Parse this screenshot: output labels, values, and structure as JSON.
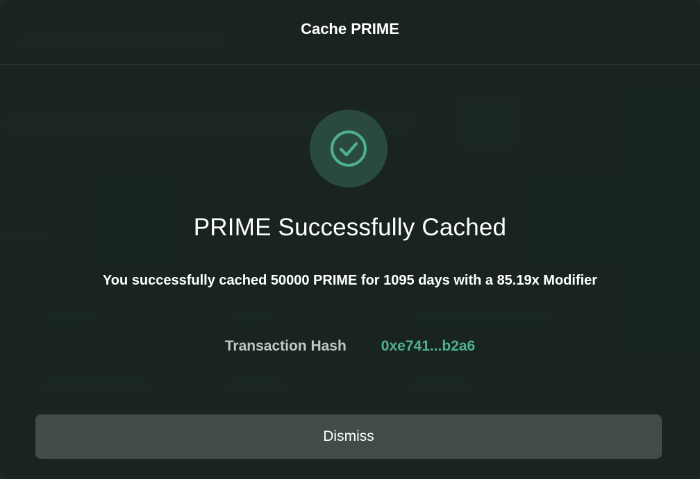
{
  "modal": {
    "title": "Cache PRIME",
    "status_icon": "check-circle-icon",
    "heading": "PRIME Successfully Cached",
    "message": "You successfully cached 50000 PRIME for 1095 days with a 85.19x Modifier",
    "transaction": {
      "label": "Transaction Hash",
      "hash": "0xe741...b2a6"
    },
    "dismiss_label": "Dismiss"
  },
  "colors": {
    "accent": "#4fb08f",
    "success_circle": "#2a4a41",
    "button_bg": "#414c4a",
    "modal_bg": "#1b2523"
  }
}
